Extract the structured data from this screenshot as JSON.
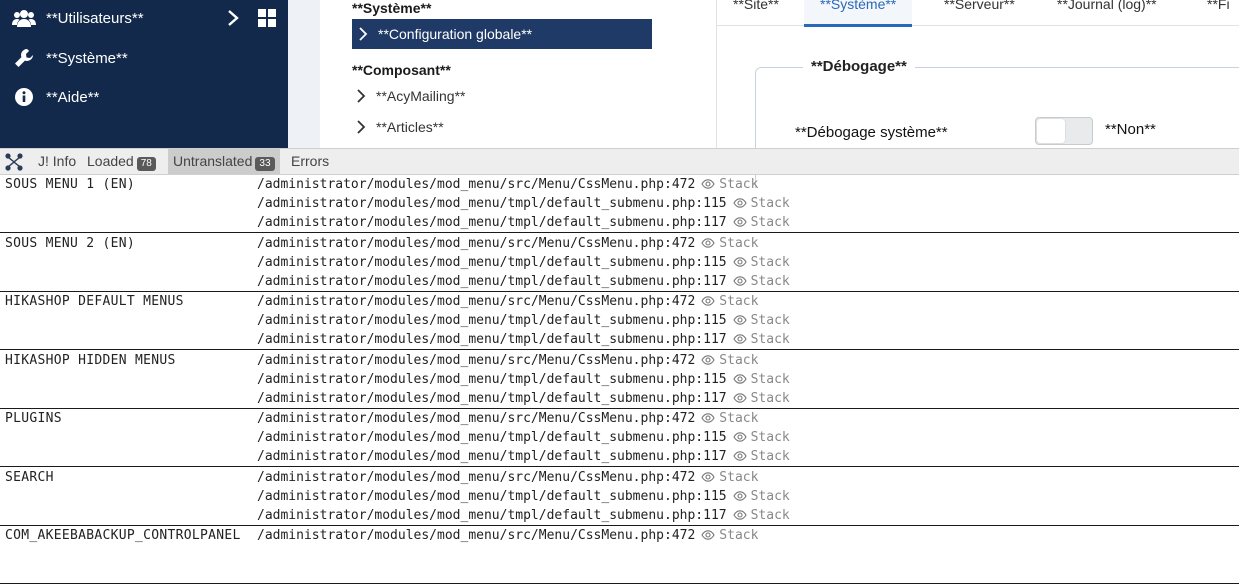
{
  "sidebar": {
    "items": [
      {
        "label": "**Utilisateurs**",
        "icon": "users-icon"
      },
      {
        "label": "**Système**",
        "icon": "wrench-icon"
      },
      {
        "label": "**Aide**",
        "icon": "info-icon"
      }
    ]
  },
  "middle": {
    "system_heading": "**Système**",
    "config_item": "**Configuration globale**",
    "component_heading": "**Composant**",
    "components": [
      "**AcyMailing**",
      "**Articles**"
    ]
  },
  "right": {
    "tabs": [
      "**Site**",
      "**Système**",
      "**Serveur**",
      "**Journal (log)**",
      "**Fi"
    ],
    "legend": "**Débogage**",
    "debug_label": "**Débogage système**",
    "toggle_value": "**Non**"
  },
  "debugbar": {
    "tabs": [
      {
        "label": "J! Info"
      },
      {
        "label": "Loaded",
        "badge": "78"
      },
      {
        "label": "Untranslated",
        "badge": "33"
      },
      {
        "label": "Errors"
      }
    ]
  },
  "rows": [
    {
      "name": "SOUS MENU 1 (EN)",
      "lines": [
        {
          "path": "/administrator/modules/mod_menu/src/Menu/CssMenu.php:472",
          "stack": "Stack"
        },
        {
          "path": "/administrator/modules/mod_menu/tmpl/default_submenu.php:115",
          "stack": "Stack"
        },
        {
          "path": "/administrator/modules/mod_menu/tmpl/default_submenu.php:117",
          "stack": "Stack"
        }
      ]
    },
    {
      "name": "SOUS MENU 2 (EN)",
      "lines": [
        {
          "path": "/administrator/modules/mod_menu/src/Menu/CssMenu.php:472",
          "stack": "Stack"
        },
        {
          "path": "/administrator/modules/mod_menu/tmpl/default_submenu.php:115",
          "stack": "Stack"
        },
        {
          "path": "/administrator/modules/mod_menu/tmpl/default_submenu.php:117",
          "stack": "Stack"
        }
      ]
    },
    {
      "name": "HIKASHOP DEFAULT MENUS",
      "lines": [
        {
          "path": "/administrator/modules/mod_menu/src/Menu/CssMenu.php:472",
          "stack": "Stack"
        },
        {
          "path": "/administrator/modules/mod_menu/tmpl/default_submenu.php:115",
          "stack": "Stack"
        },
        {
          "path": "/administrator/modules/mod_menu/tmpl/default_submenu.php:117",
          "stack": "Stack"
        }
      ]
    },
    {
      "name": "HIKASHOP HIDDEN MENUS",
      "lines": [
        {
          "path": "/administrator/modules/mod_menu/src/Menu/CssMenu.php:472",
          "stack": "Stack"
        },
        {
          "path": "/administrator/modules/mod_menu/tmpl/default_submenu.php:115",
          "stack": "Stack"
        },
        {
          "path": "/administrator/modules/mod_menu/tmpl/default_submenu.php:117",
          "stack": "Stack"
        }
      ]
    },
    {
      "name": "PLUGINS",
      "lines": [
        {
          "path": "/administrator/modules/mod_menu/src/Menu/CssMenu.php:472",
          "stack": "Stack"
        },
        {
          "path": "/administrator/modules/mod_menu/tmpl/default_submenu.php:115",
          "stack": "Stack"
        },
        {
          "path": "/administrator/modules/mod_menu/tmpl/default_submenu.php:117",
          "stack": "Stack"
        }
      ]
    },
    {
      "name": "SEARCH",
      "lines": [
        {
          "path": "/administrator/modules/mod_menu/src/Menu/CssMenu.php:472",
          "stack": "Stack"
        },
        {
          "path": "/administrator/modules/mod_menu/tmpl/default_submenu.php:115",
          "stack": "Stack"
        },
        {
          "path": "/administrator/modules/mod_menu/tmpl/default_submenu.php:117",
          "stack": "Stack"
        }
      ]
    },
    {
      "name": "COM_AKEEBABACKUP_CONTROLPANEL",
      "lines": [
        {
          "path": "/administrator/modules/mod_menu/src/Menu/CssMenu.php:472",
          "stack": "Stack"
        }
      ]
    }
  ]
}
